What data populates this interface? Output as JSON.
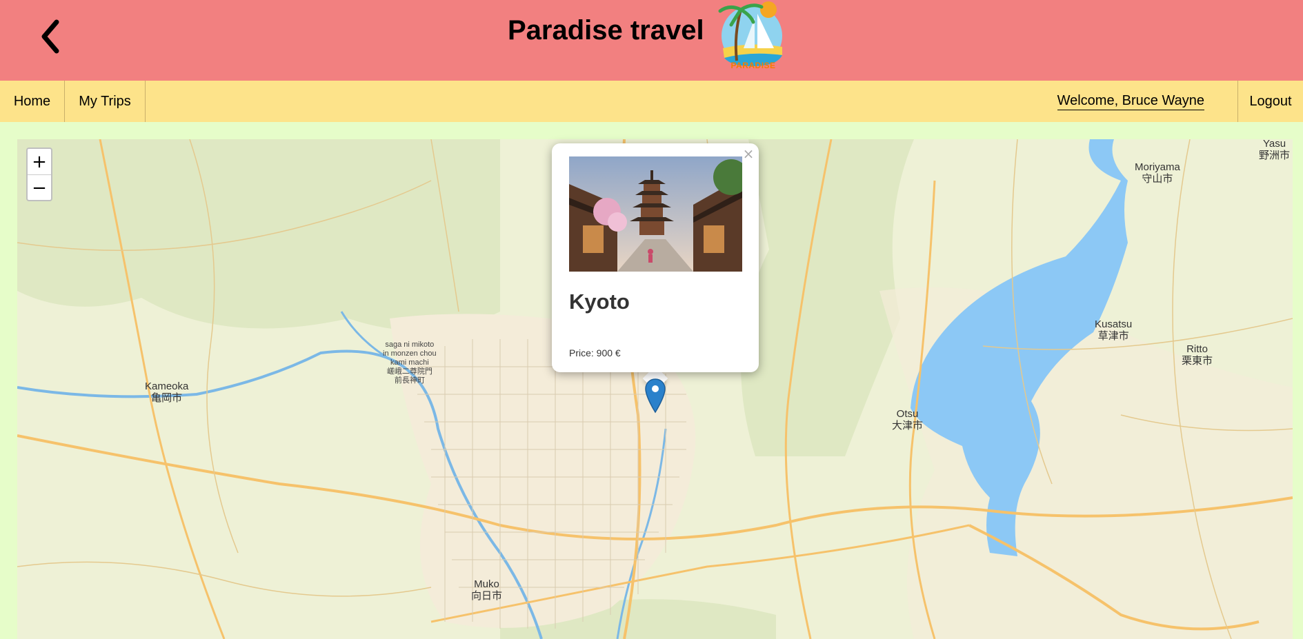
{
  "header": {
    "back_icon": "chevron-left-icon",
    "title": "Paradise travel",
    "logo_text": "PARADISE"
  },
  "nav": {
    "home": "Home",
    "my_trips": "My Trips",
    "welcome": "Welcome, Bruce Wayne",
    "logout": "Logout"
  },
  "map": {
    "zoom_in": "+",
    "zoom_out": "−",
    "labels": {
      "kameoka": "Kameoka",
      "kameoka_jp": "亀岡市",
      "otsu": "Otsu",
      "otsu_jp": "大津市",
      "moriyama": "Moriyama",
      "moriyama_jp": "守山市",
      "kusatsu": "Kusatsu",
      "kusatsu_jp": "草津市",
      "ritto": "Ritto",
      "ritto_jp": "栗東市",
      "muko": "Muko",
      "muko_jp": "向日市",
      "yasu": "Yasu",
      "yasu_jp": "野洲市",
      "saga_l1": "saga ni mikoto",
      "saga_l2": "in monzen chou",
      "saga_l3": "kami machi",
      "saga_l4": "嵯峨二尊院門",
      "saga_l5": "前長神町"
    },
    "colors": {
      "lake": "#8cc8f5",
      "road_major": "#f6c26b",
      "land": "#eef1d6"
    }
  },
  "popup": {
    "close": "×",
    "title": "Kyoto",
    "price": "Price: 900 €"
  }
}
